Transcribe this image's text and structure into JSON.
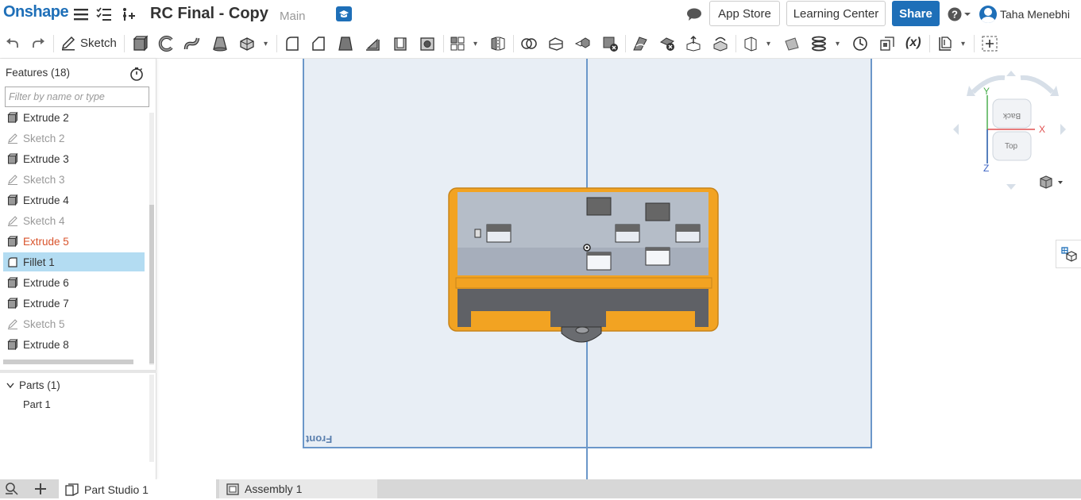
{
  "header": {
    "logo": "Onshape",
    "doc_title": "RC Final - Copy",
    "branch": "Main",
    "app_store": "App Store",
    "learning_center": "Learning Center",
    "share": "Share",
    "user_name": "Taha Menebhi"
  },
  "toolbar": {
    "sketch_label": "Sketch",
    "variable_label": "(x)"
  },
  "feature_panel": {
    "title": "Features (18)",
    "filter_placeholder": "Filter by name or type",
    "features": [
      {
        "label": "Extrude 2",
        "kind": "extrude",
        "state": "normal"
      },
      {
        "label": "Sketch 2",
        "kind": "sketch",
        "state": "normal"
      },
      {
        "label": "Extrude 3",
        "kind": "extrude",
        "state": "normal"
      },
      {
        "label": "Sketch 3",
        "kind": "sketch",
        "state": "normal"
      },
      {
        "label": "Extrude 4",
        "kind": "extrude",
        "state": "normal"
      },
      {
        "label": "Sketch 4",
        "kind": "sketch",
        "state": "normal"
      },
      {
        "label": "Extrude 5",
        "kind": "extrude",
        "state": "error"
      },
      {
        "label": "Fillet 1",
        "kind": "fillet",
        "state": "selected"
      },
      {
        "label": "Extrude 6",
        "kind": "extrude",
        "state": "normal"
      },
      {
        "label": "Extrude 7",
        "kind": "extrude",
        "state": "normal"
      },
      {
        "label": "Sketch 5",
        "kind": "sketch",
        "state": "normal"
      },
      {
        "label": "Extrude 8",
        "kind": "extrude",
        "state": "normal"
      }
    ],
    "parts_header": "Parts (1)",
    "parts": [
      "Part 1"
    ]
  },
  "viewport": {
    "plane_label": "Front"
  },
  "navcube": {
    "face_back": "Back",
    "face_top": "Top",
    "axis_x": "X",
    "axis_y": "Y",
    "axis_z": "Z"
  },
  "tabs": {
    "part_studio": "Part Studio 1",
    "assembly": "Assembly 1"
  },
  "colors": {
    "brand_blue": "#1e6fb8",
    "part_orange": "#f2a322",
    "error_orange": "#d9532b",
    "selected_row": "#b3dcf2"
  }
}
